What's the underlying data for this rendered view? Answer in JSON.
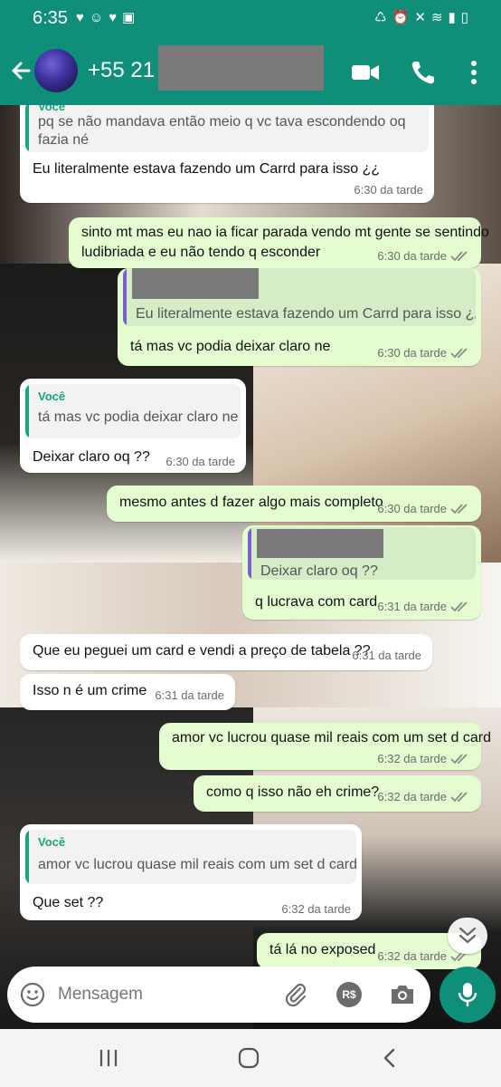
{
  "status_bar": {
    "time": "6:35",
    "icons_left": [
      "heart-icon",
      "cat-icon",
      "heart-icon",
      "image-icon"
    ],
    "icons_right": [
      "battery-saver-icon",
      "alarm-icon",
      "mute-icon",
      "wifi-icon",
      "signal-icon",
      "battery-icon"
    ]
  },
  "header": {
    "contact": "+55 21",
    "back_icon": "arrow-left-icon",
    "actions": [
      "video-call-icon",
      "phone-icon",
      "more-vert-icon"
    ]
  },
  "colors": {
    "header": "#0f8f7a",
    "incoming": "#ffffff",
    "outgoing": "#e4fccf",
    "quote_name": "#1aa37f",
    "quote_bar_in": "#1aa37f",
    "quote_bar_out": "#7b5fd0",
    "ticks": "#8a8a8a"
  },
  "messages": [
    {
      "dir": "in",
      "reply_name": "Você",
      "reply_lines": [
        "pq se não mandava então meio q vc tava escondendo oq",
        "fazia né"
      ],
      "lines": [
        "Eu literalmente estava fazendo um Carrd para isso ¿¿"
      ],
      "time": "6:30 da tarde"
    },
    {
      "dir": "out",
      "lines": [
        "sinto mt mas eu nao ia ficar parada vendo mt gente se sentindo",
        "ludibriada e eu não tendo q esconder"
      ],
      "time": "6:30 da tarde"
    },
    {
      "dir": "out",
      "reply_lines": [
        "Eu literalmente estava fazendo um Carrd para isso ¿¿"
      ],
      "lines": [
        "tá mas vc podia deixar claro ne"
      ],
      "time": "6:30 da tarde"
    },
    {
      "dir": "in",
      "reply_name": "Você",
      "reply_lines": [
        "tá mas vc podia deixar claro ne"
      ],
      "lines": [
        "Deixar claro oq ??"
      ],
      "time": "6:30 da tarde"
    },
    {
      "dir": "out",
      "lines": [
        "mesmo antes d fazer algo mais completo"
      ],
      "time": "6:30 da tarde"
    },
    {
      "dir": "out",
      "reply_lines": [
        "Deixar claro oq ??"
      ],
      "lines": [
        "q lucrava com card"
      ],
      "time": "6:31 da tarde"
    },
    {
      "dir": "in",
      "lines": [
        "Que eu peguei um card e vendi a preço de tabela ??"
      ],
      "time": "6:31 da tarde"
    },
    {
      "dir": "in",
      "lines": [
        "Isso n é um crime"
      ],
      "time": "6:31 da tarde"
    },
    {
      "dir": "out",
      "lines": [
        "amor vc lucrou quase mil reais com um set d card"
      ],
      "time": "6:32 da tarde"
    },
    {
      "dir": "out",
      "lines": [
        "como q isso não eh crime?"
      ],
      "time": "6:32 da tarde"
    },
    {
      "dir": "in",
      "reply_name": "Você",
      "reply_lines": [
        "amor vc lucrou quase mil reais com um set d card"
      ],
      "lines": [
        "Que set ??"
      ],
      "time": "6:32 da tarde"
    },
    {
      "dir": "out",
      "lines": [
        "tá lá no exposed"
      ],
      "time": "6:32 da tarde"
    }
  ],
  "input": {
    "placeholder": "Mensagem",
    "icons": [
      "emoji-icon",
      "attach-icon",
      "payment-icon",
      "camera-icon",
      "mic-icon"
    ],
    "payment_label": "R$"
  },
  "scroll_icon": "double-chevron-down-icon",
  "nav": [
    "recent-apps-icon",
    "home-icon",
    "back-icon"
  ]
}
